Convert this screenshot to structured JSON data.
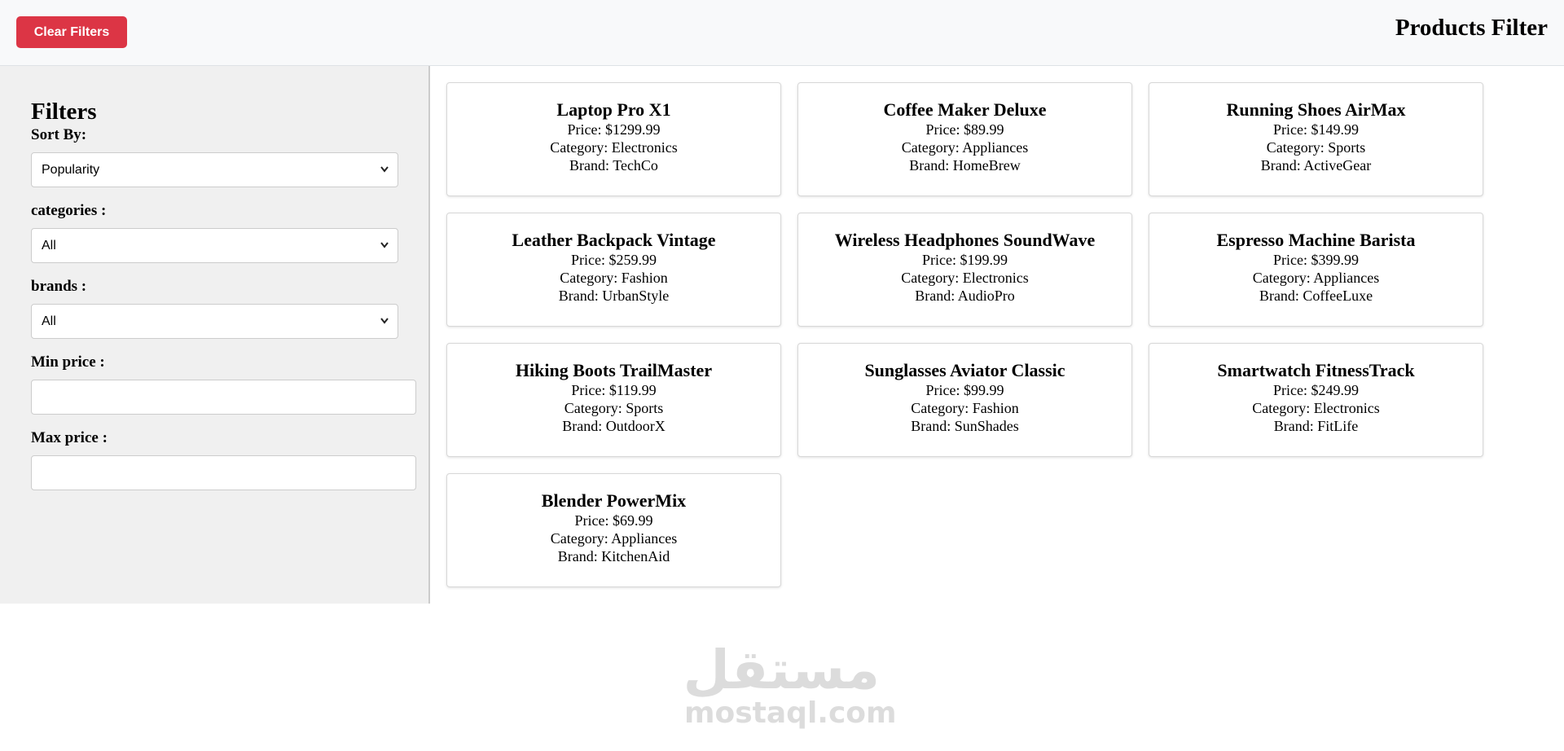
{
  "header": {
    "clear_label": "Clear Filters",
    "title": "Products Filter"
  },
  "sidebar": {
    "heading": "Filters",
    "sort_label": "Sort By:",
    "sort_value": "Popularity",
    "categories_label": "categories :",
    "categories_value": "All",
    "brands_label": "brands :",
    "brands_value": "All",
    "min_label": "Min price :",
    "min_value": "",
    "max_label": "Max price :",
    "max_value": ""
  },
  "products": [
    {
      "name": "Laptop Pro X1",
      "price": "Price: $1299.99",
      "category": "Category: Electronics",
      "brand": "Brand: TechCo"
    },
    {
      "name": "Coffee Maker Deluxe",
      "price": "Price: $89.99",
      "category": "Category: Appliances",
      "brand": "Brand: HomeBrew"
    },
    {
      "name": "Running Shoes AirMax",
      "price": "Price: $149.99",
      "category": "Category: Sports",
      "brand": "Brand: ActiveGear"
    },
    {
      "name": "Leather Backpack Vintage",
      "price": "Price: $259.99",
      "category": "Category: Fashion",
      "brand": "Brand: UrbanStyle"
    },
    {
      "name": "Wireless Headphones SoundWave",
      "price": "Price: $199.99",
      "category": "Category: Electronics",
      "brand": "Brand: AudioPro"
    },
    {
      "name": "Espresso Machine Barista",
      "price": "Price: $399.99",
      "category": "Category: Appliances",
      "brand": "Brand: CoffeeLuxe"
    },
    {
      "name": "Hiking Boots TrailMaster",
      "price": "Price: $119.99",
      "category": "Category: Sports",
      "brand": "Brand: OutdoorX"
    },
    {
      "name": "Sunglasses Aviator Classic",
      "price": "Price: $99.99",
      "category": "Category: Fashion",
      "brand": "Brand: SunShades"
    },
    {
      "name": "Smartwatch FitnessTrack",
      "price": "Price: $249.99",
      "category": "Category: Electronics",
      "brand": "Brand: FitLife"
    },
    {
      "name": "Blender PowerMix",
      "price": "Price: $69.99",
      "category": "Category: Appliances",
      "brand": "Brand: KitchenAid"
    }
  ],
  "watermark": {
    "logo": "مستقل",
    "text": "mostaql.com"
  },
  "colors": {
    "clear_button": "#dc3545",
    "header_bg": "#f8f9fa",
    "sidebar_bg": "#f0f0f0"
  },
  "icons": {
    "select_arrow": "chevron-down-icon"
  }
}
